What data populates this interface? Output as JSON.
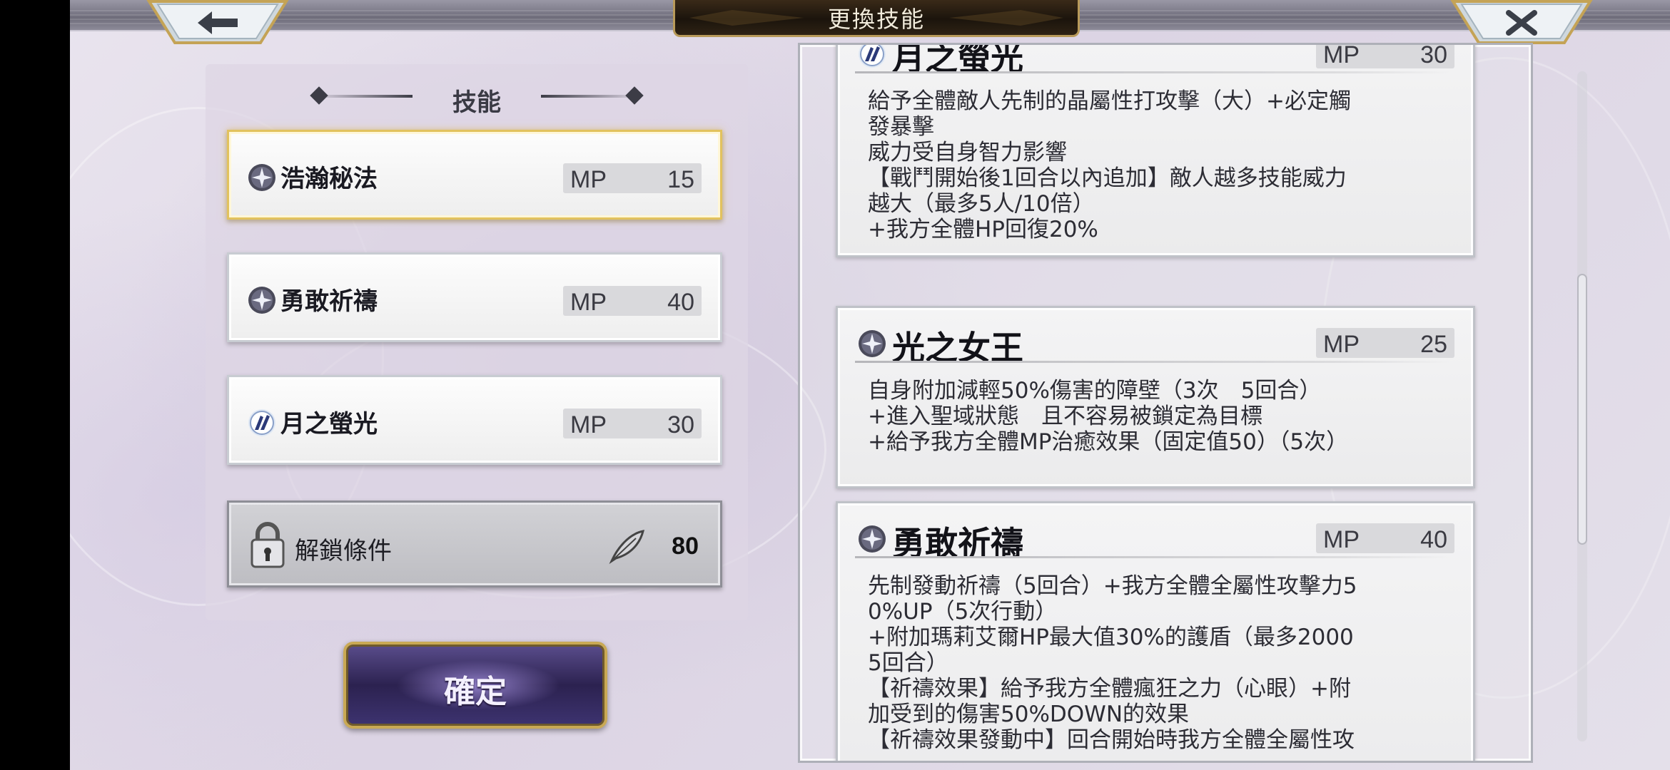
{
  "header": {
    "title": "更換技能"
  },
  "skills_panel": {
    "title": "技能",
    "skills": [
      {
        "name": "浩瀚秘法",
        "mp_label": "MP",
        "mp": "15",
        "icon": "light-element-icon",
        "selected": true
      },
      {
        "name": "勇敢祈禱",
        "mp_label": "MP",
        "mp": "40",
        "icon": "light-element-icon",
        "selected": false
      },
      {
        "name": "月之螢光",
        "mp_label": "MP",
        "mp": "30",
        "icon": "crystal-element-icon",
        "selected": false
      }
    ],
    "unlock": {
      "label": "解鎖條件",
      "cost": "80",
      "icon": "feather-icon"
    }
  },
  "confirm": {
    "label": "確定"
  },
  "details": [
    {
      "name": "月之螢光",
      "mp_label": "MP",
      "mp": "30",
      "icon": "crystal-element-icon",
      "description": "給予全體敵人先制的晶屬性打攻擊（大）+必定觸\n發暴擊\n威力受自身智力影響\n【戰鬥開始後1回合以內追加】敵人越多技能威力\n越大（最多5人/10倍）\n+我方全體HP回復20%"
    },
    {
      "name": "光之女王",
      "mp_label": "MP",
      "mp": "25",
      "icon": "light-element-icon",
      "description": "自身附加減輕50%傷害的障壁（3次　5回合）\n+進入聖域狀態　且不容易被鎖定為目標\n+給予我方全體MP治癒效果（固定值50）（5次）"
    },
    {
      "name": "勇敢祈禱",
      "mp_label": "MP",
      "mp": "40",
      "icon": "light-element-icon",
      "description": "先制發動祈禱（5回合）+我方全體全屬性攻擊力5\n0%UP（5次行動）\n+附加瑪莉艾爾HP最大值30%的護盾（最多2000\n5回合）\n【祈禱效果】給予我方全體瘋狂之力（心眼）+附\n加受到的傷害50%DOWN的效果\n【祈禱效果發動中】回合開始時我方全體全屬性攻"
    }
  ],
  "colors": {
    "selected_border": "#e2c25e",
    "confirm_bg": "#2c2250",
    "gold_trim": "#c9a955"
  }
}
